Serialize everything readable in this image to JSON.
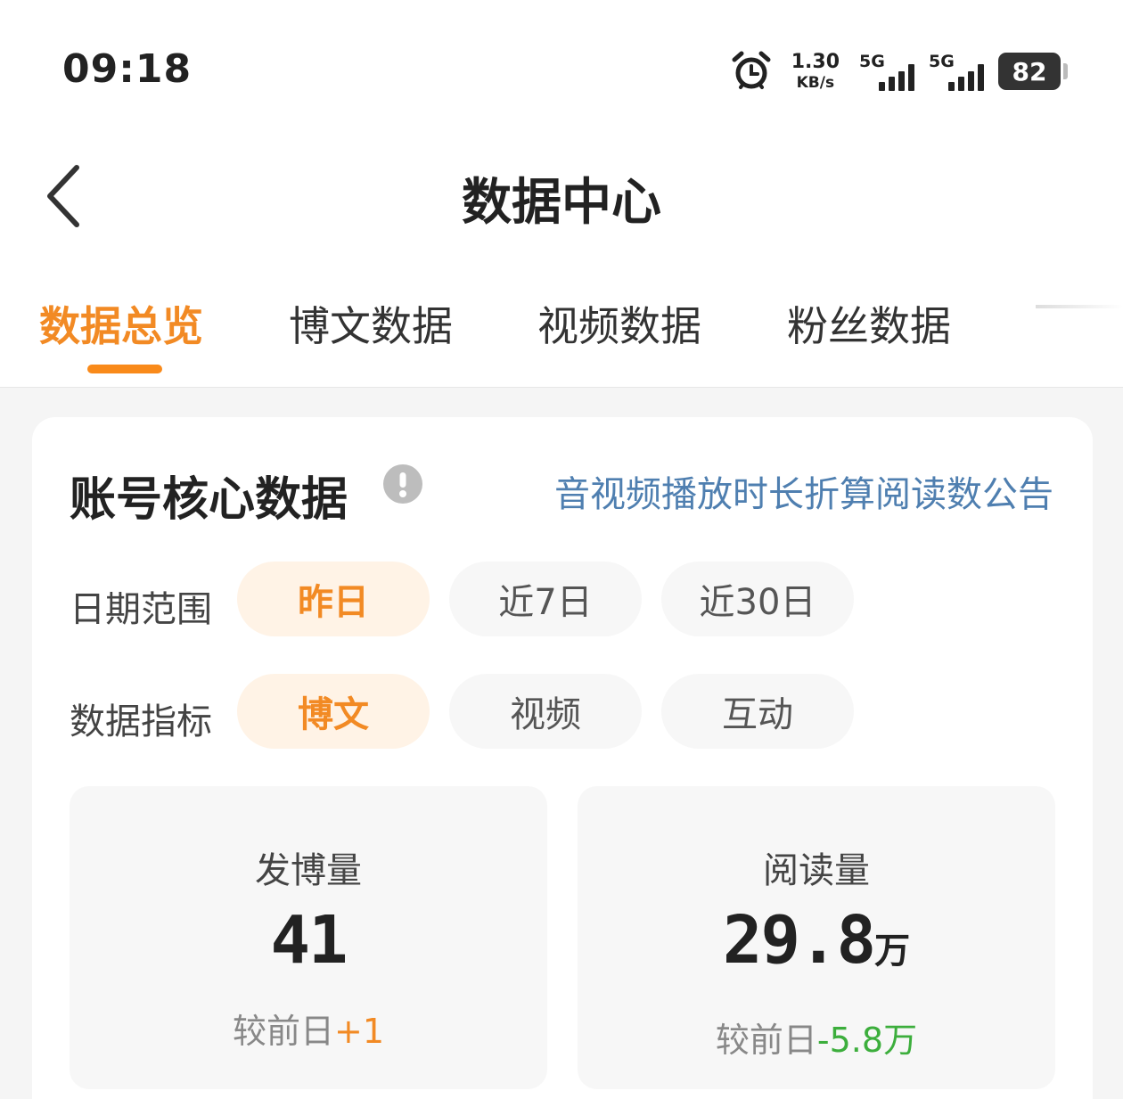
{
  "status_bar": {
    "time": "09:18",
    "net_speed_value": "1.30",
    "net_speed_unit": "KB/s",
    "sim1_label": "5G",
    "sim2_label": "5G",
    "battery": "82",
    "icons": [
      "alarm-icon",
      "signal-icon",
      "signal-icon",
      "battery-icon"
    ]
  },
  "nav": {
    "title": "数据中心",
    "back_icon": "chevron-left-icon"
  },
  "tabs": [
    {
      "label": "数据总览",
      "active": true
    },
    {
      "label": "博文数据",
      "active": false
    },
    {
      "label": "视频数据",
      "active": false
    },
    {
      "label": "粉丝数据",
      "active": false
    }
  ],
  "core": {
    "title": "账号核心数据",
    "info_icon": "exclamation-icon",
    "notice_link": "音视频播放时长折算阅读数公告",
    "date_range": {
      "label": "日期范围",
      "options": [
        "昨日",
        "近7日",
        "近30日"
      ],
      "selected": "昨日"
    },
    "metric": {
      "label": "数据指标",
      "options": [
        "博文",
        "视频",
        "互动"
      ],
      "selected": "博文"
    },
    "stats": [
      {
        "name": "发博量",
        "value": "41",
        "unit": "",
        "compare_label": "较前日",
        "compare_value": "+1"
      },
      {
        "name": "阅读量",
        "value": "29.8",
        "unit": "万",
        "compare_label": "较前日",
        "compare_value": "-5.8万"
      }
    ]
  },
  "colors": {
    "accent": "#f28a24",
    "link": "#4f7fb0",
    "positive_change": "#f28a24",
    "negative_change": "#3cae3c"
  }
}
